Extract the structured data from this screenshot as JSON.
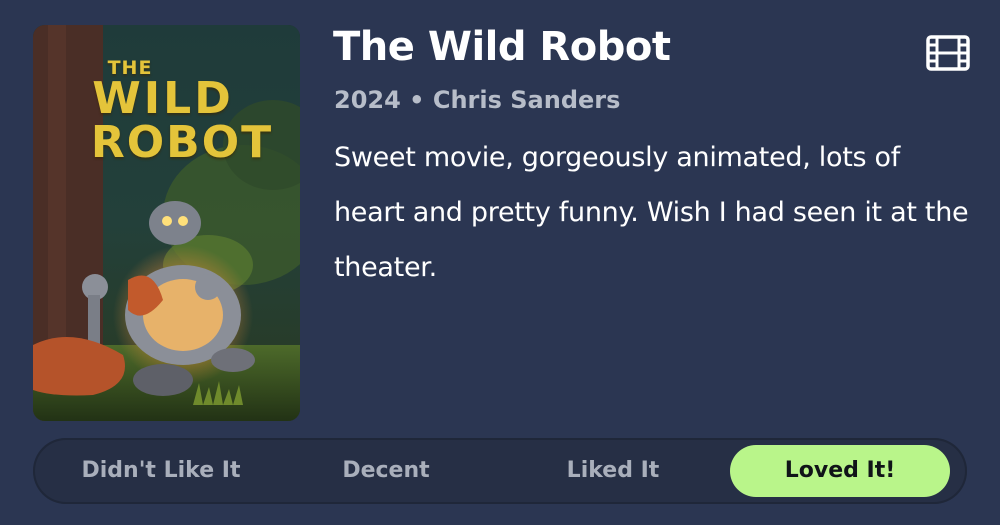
{
  "movie": {
    "title": "The Wild Robot",
    "meta": "2024 • Chris Sanders",
    "review": "Sweet movie, gorgeously animated, lots of heart and pretty funny. Wish I had seen it at the theater."
  },
  "poster": {
    "title_line1": "THE",
    "title_line2": "WILD",
    "title_line3": "ROBOT"
  },
  "icons": {
    "film": "film-icon"
  },
  "rating": {
    "options": [
      {
        "label": "Didn't Like It",
        "selected": false
      },
      {
        "label": "Decent",
        "selected": false
      },
      {
        "label": "Liked It",
        "selected": false
      },
      {
        "label": "Loved It!",
        "selected": true
      }
    ]
  },
  "colors": {
    "background": "#2b3652",
    "selected_option": "#b9f58a",
    "title_text": "#ffffff",
    "meta_text": "#b7bdc9"
  }
}
